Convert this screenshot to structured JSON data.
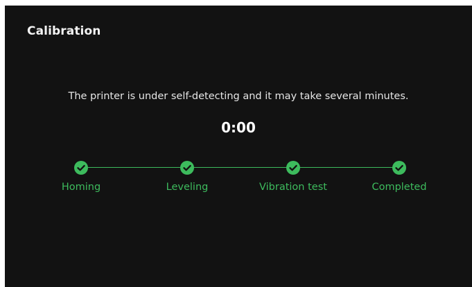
{
  "header": {
    "title": "Calibration"
  },
  "main": {
    "message": "The printer is under self-detecting and it may take several minutes.",
    "timer": "0:00",
    "steps": [
      {
        "label": "Homing",
        "status": "completed",
        "icon": "check-icon"
      },
      {
        "label": "Leveling",
        "status": "completed",
        "icon": "check-icon"
      },
      {
        "label": "Vibration test",
        "status": "completed",
        "icon": "check-icon"
      },
      {
        "label": "Completed",
        "status": "completed",
        "icon": "check-icon"
      }
    ]
  },
  "colors": {
    "background": "#121212",
    "accent": "#3dbb5d",
    "text": "#ffffff"
  }
}
